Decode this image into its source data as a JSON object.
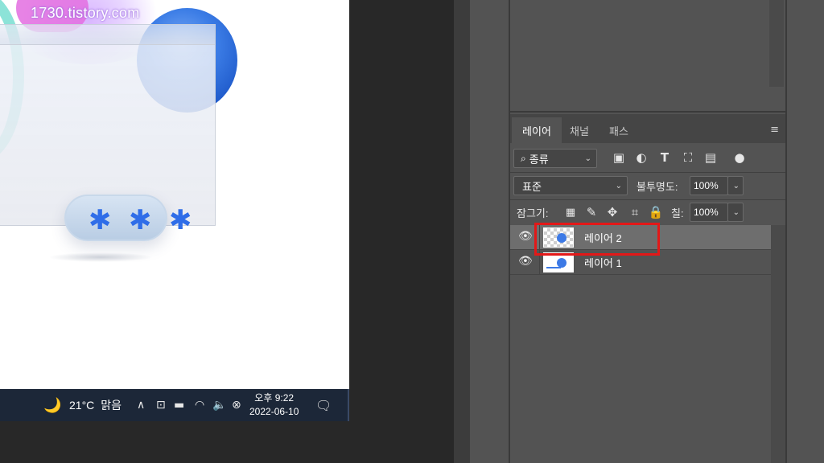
{
  "watermark": "1730.tistory.com",
  "taskbar": {
    "weather_icon": "moon-icon",
    "temperature": "21°C",
    "condition": "맑음",
    "tray_icons": [
      "chevron-up-icon",
      "meet-now-icon",
      "battery-icon",
      "wifi-icon",
      "volume-icon",
      "close-circle-icon",
      "notification-icon"
    ],
    "time": "오후 9:22",
    "date": "2022-06-10"
  },
  "layers_panel": {
    "tabs": [
      {
        "label": "레이어",
        "active": true
      },
      {
        "label": "채널",
        "active": false
      },
      {
        "label": "패스",
        "active": false
      }
    ],
    "filter": {
      "value": "종류",
      "icons": [
        "image-filter-icon",
        "adjustment-filter-icon",
        "type-filter-icon",
        "shape-filter-icon",
        "smart-object-filter-icon",
        "filter-toggle-icon"
      ]
    },
    "blend_mode": "표준",
    "opacity_label": "불투명도:",
    "opacity_value": "100%",
    "lock_label": "잠그기:",
    "lock_icons": [
      "lock-transparent-icon",
      "lock-paint-icon",
      "lock-move-icon",
      "lock-artboard-icon",
      "lock-all-icon"
    ],
    "fill_label": "칠:",
    "fill_value": "100%",
    "layers": [
      {
        "name": "레이어 2",
        "selected": true,
        "visible": true
      },
      {
        "name": "레이어 1",
        "selected": false,
        "visible": true
      }
    ]
  },
  "colors": {
    "highlight": "#e31818",
    "panel_bg": "#535353",
    "taskbar_bg": "#1c2738"
  }
}
